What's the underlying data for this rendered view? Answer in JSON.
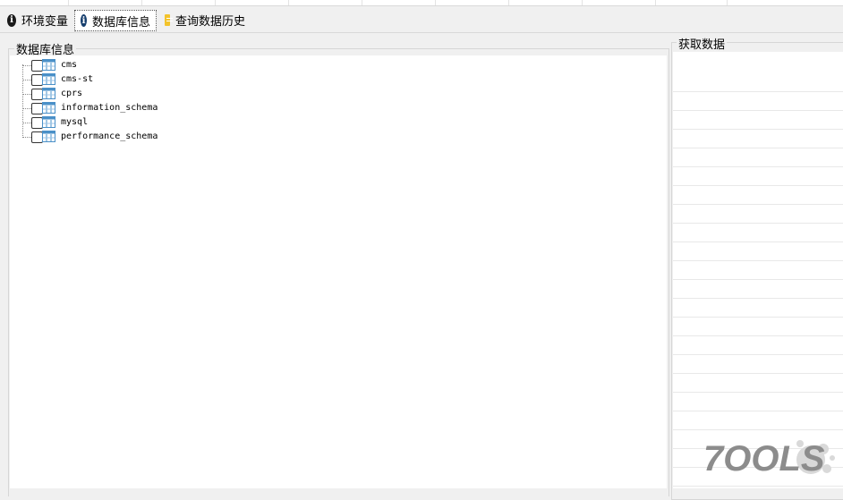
{
  "tabs": [
    {
      "label": "环境变量",
      "icon": "info-icon",
      "active": false
    },
    {
      "label": "数据库信息",
      "icon": "info-icon",
      "active": true
    },
    {
      "label": "查询数据历史",
      "icon": "document-icon",
      "active": false
    }
  ],
  "left_panel": {
    "title": "数据库信息",
    "databases": [
      "cms",
      "cms-st",
      "cprs",
      "information_schema",
      "mysql",
      "performance_schema"
    ]
  },
  "right_panel": {
    "title": "获取数据"
  },
  "watermark": {
    "text": "7OOLS"
  },
  "colors": {
    "accent": "#173f6e",
    "tab_icon": "#f3c32b"
  }
}
